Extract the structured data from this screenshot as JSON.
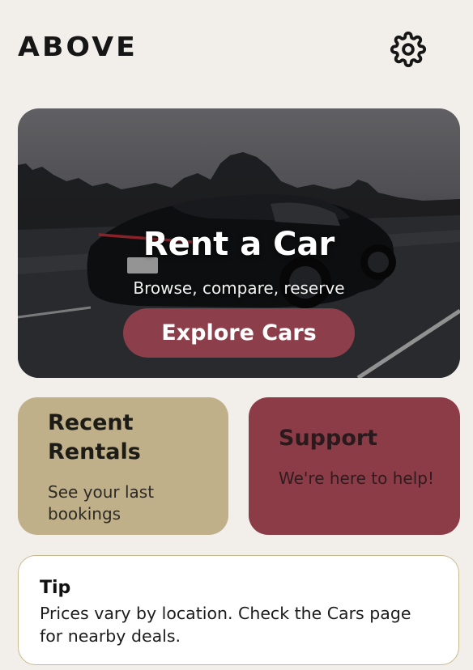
{
  "header": {
    "logo": "ABOVE",
    "settings_icon": "gear-icon"
  },
  "hero": {
    "title": "Rent a Car",
    "subtitle": "Browse, compare, reserve",
    "cta_label": "Explore Cars"
  },
  "cards": {
    "recent": {
      "title": "Recent Rentals",
      "body": "See your last bookings"
    },
    "support": {
      "title": "Support",
      "body": "We're here to help!"
    }
  },
  "tip": {
    "title": "Tip",
    "body": "Prices vary by location. Check the Cars page for nearby deals."
  },
  "colors": {
    "background": "#f2efeb",
    "accent": "#8c3f4b",
    "recent_card": "#bfb08a",
    "support_card": "#8b3c46",
    "tip_border": "#c8b98d"
  }
}
